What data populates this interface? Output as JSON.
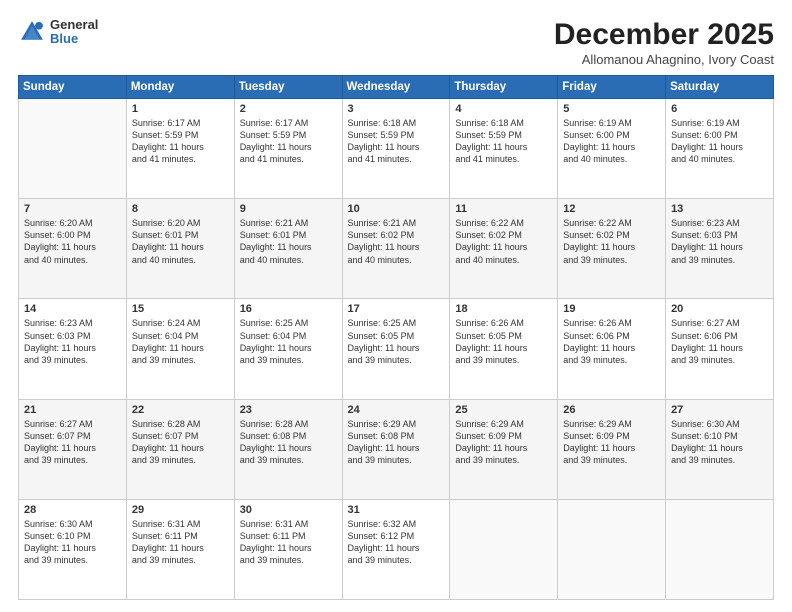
{
  "header": {
    "logo": {
      "general": "General",
      "blue": "Blue"
    },
    "title": "December 2025",
    "subtitle": "Allomanou Ahagnino, Ivory Coast"
  },
  "days_of_week": [
    "Sunday",
    "Monday",
    "Tuesday",
    "Wednesday",
    "Thursday",
    "Friday",
    "Saturday"
  ],
  "weeks": [
    [
      {
        "day": "",
        "info": ""
      },
      {
        "day": "1",
        "info": "Sunrise: 6:17 AM\nSunset: 5:59 PM\nDaylight: 11 hours\nand 41 minutes."
      },
      {
        "day": "2",
        "info": "Sunrise: 6:17 AM\nSunset: 5:59 PM\nDaylight: 11 hours\nand 41 minutes."
      },
      {
        "day": "3",
        "info": "Sunrise: 6:18 AM\nSunset: 5:59 PM\nDaylight: 11 hours\nand 41 minutes."
      },
      {
        "day": "4",
        "info": "Sunrise: 6:18 AM\nSunset: 5:59 PM\nDaylight: 11 hours\nand 41 minutes."
      },
      {
        "day": "5",
        "info": "Sunrise: 6:19 AM\nSunset: 6:00 PM\nDaylight: 11 hours\nand 40 minutes."
      },
      {
        "day": "6",
        "info": "Sunrise: 6:19 AM\nSunset: 6:00 PM\nDaylight: 11 hours\nand 40 minutes."
      }
    ],
    [
      {
        "day": "7",
        "info": "Sunrise: 6:20 AM\nSunset: 6:00 PM\nDaylight: 11 hours\nand 40 minutes."
      },
      {
        "day": "8",
        "info": "Sunrise: 6:20 AM\nSunset: 6:01 PM\nDaylight: 11 hours\nand 40 minutes."
      },
      {
        "day": "9",
        "info": "Sunrise: 6:21 AM\nSunset: 6:01 PM\nDaylight: 11 hours\nand 40 minutes."
      },
      {
        "day": "10",
        "info": "Sunrise: 6:21 AM\nSunset: 6:02 PM\nDaylight: 11 hours\nand 40 minutes."
      },
      {
        "day": "11",
        "info": "Sunrise: 6:22 AM\nSunset: 6:02 PM\nDaylight: 11 hours\nand 40 minutes."
      },
      {
        "day": "12",
        "info": "Sunrise: 6:22 AM\nSunset: 6:02 PM\nDaylight: 11 hours\nand 39 minutes."
      },
      {
        "day": "13",
        "info": "Sunrise: 6:23 AM\nSunset: 6:03 PM\nDaylight: 11 hours\nand 39 minutes."
      }
    ],
    [
      {
        "day": "14",
        "info": "Sunrise: 6:23 AM\nSunset: 6:03 PM\nDaylight: 11 hours\nand 39 minutes."
      },
      {
        "day": "15",
        "info": "Sunrise: 6:24 AM\nSunset: 6:04 PM\nDaylight: 11 hours\nand 39 minutes."
      },
      {
        "day": "16",
        "info": "Sunrise: 6:25 AM\nSunset: 6:04 PM\nDaylight: 11 hours\nand 39 minutes."
      },
      {
        "day": "17",
        "info": "Sunrise: 6:25 AM\nSunset: 6:05 PM\nDaylight: 11 hours\nand 39 minutes."
      },
      {
        "day": "18",
        "info": "Sunrise: 6:26 AM\nSunset: 6:05 PM\nDaylight: 11 hours\nand 39 minutes."
      },
      {
        "day": "19",
        "info": "Sunrise: 6:26 AM\nSunset: 6:06 PM\nDaylight: 11 hours\nand 39 minutes."
      },
      {
        "day": "20",
        "info": "Sunrise: 6:27 AM\nSunset: 6:06 PM\nDaylight: 11 hours\nand 39 minutes."
      }
    ],
    [
      {
        "day": "21",
        "info": "Sunrise: 6:27 AM\nSunset: 6:07 PM\nDaylight: 11 hours\nand 39 minutes."
      },
      {
        "day": "22",
        "info": "Sunrise: 6:28 AM\nSunset: 6:07 PM\nDaylight: 11 hours\nand 39 minutes."
      },
      {
        "day": "23",
        "info": "Sunrise: 6:28 AM\nSunset: 6:08 PM\nDaylight: 11 hours\nand 39 minutes."
      },
      {
        "day": "24",
        "info": "Sunrise: 6:29 AM\nSunset: 6:08 PM\nDaylight: 11 hours\nand 39 minutes."
      },
      {
        "day": "25",
        "info": "Sunrise: 6:29 AM\nSunset: 6:09 PM\nDaylight: 11 hours\nand 39 minutes."
      },
      {
        "day": "26",
        "info": "Sunrise: 6:29 AM\nSunset: 6:09 PM\nDaylight: 11 hours\nand 39 minutes."
      },
      {
        "day": "27",
        "info": "Sunrise: 6:30 AM\nSunset: 6:10 PM\nDaylight: 11 hours\nand 39 minutes."
      }
    ],
    [
      {
        "day": "28",
        "info": "Sunrise: 6:30 AM\nSunset: 6:10 PM\nDaylight: 11 hours\nand 39 minutes."
      },
      {
        "day": "29",
        "info": "Sunrise: 6:31 AM\nSunset: 6:11 PM\nDaylight: 11 hours\nand 39 minutes."
      },
      {
        "day": "30",
        "info": "Sunrise: 6:31 AM\nSunset: 6:11 PM\nDaylight: 11 hours\nand 39 minutes."
      },
      {
        "day": "31",
        "info": "Sunrise: 6:32 AM\nSunset: 6:12 PM\nDaylight: 11 hours\nand 39 minutes."
      },
      {
        "day": "",
        "info": ""
      },
      {
        "day": "",
        "info": ""
      },
      {
        "day": "",
        "info": ""
      }
    ]
  ]
}
